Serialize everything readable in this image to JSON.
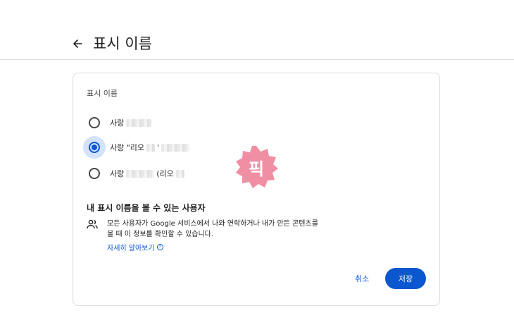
{
  "header": {
    "title": "표시 이름"
  },
  "card": {
    "section_label": "표시 이름",
    "options": [
      {
        "label": "사랑",
        "suffix": "",
        "selected": false
      },
      {
        "label": "사랑 \"리오",
        "suffix": "'",
        "selected": true
      },
      {
        "label": "사랑",
        "suffix": "(리오",
        "selected": false
      }
    ],
    "who_title": "내 표시 이름을 볼 수 있는 사용자",
    "who_desc": "모든 사용자가 Google 서비스에서 나와 연락하거나 내가 만든 콘텐츠를 볼 때 이 정보를 확인할 수 있습니다.",
    "learn_more": "자세히 알아보기",
    "cancel_label": "취소",
    "save_label": "저장"
  },
  "badge": {
    "text": "픽",
    "color": "#f08fa3"
  },
  "colors": {
    "accent": "#0b57d0",
    "selected_bg": "#d3e3fd"
  }
}
